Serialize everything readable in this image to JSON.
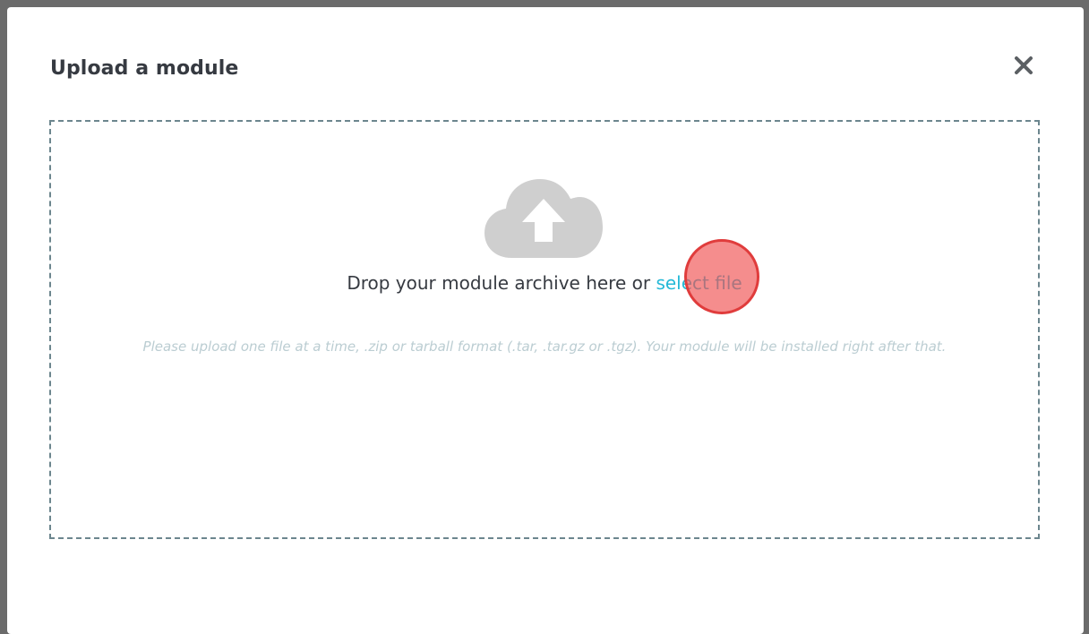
{
  "modal": {
    "title": "Upload a module",
    "close_icon": "close-icon"
  },
  "dropzone": {
    "icon": "cloud-upload-icon",
    "prompt_prefix": "Drop your module archive here or ",
    "select_link": "select file",
    "help_text": "Please upload one file at a time, .zip or tarball format (.tar, .tar.gz or .tgz). Your module will be installed right after that."
  },
  "colors": {
    "title": "#363a41",
    "link": "#25b9d7",
    "dropzone_border": "#6c868e",
    "help_text": "#bbcdd2",
    "icon": "#cfcfcf"
  }
}
